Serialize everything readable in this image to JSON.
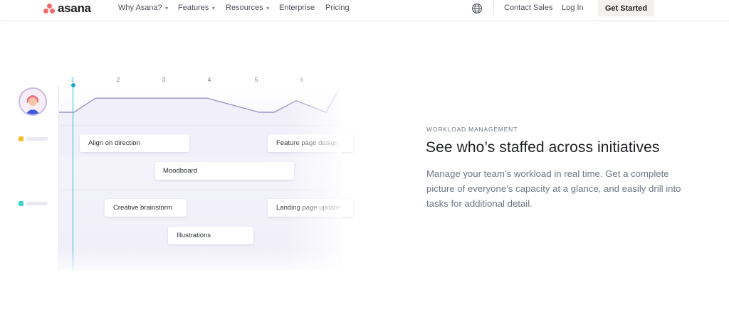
{
  "nav": {
    "logo_text": "asana",
    "links": [
      {
        "label": "Why Asana?",
        "has_caret": true
      },
      {
        "label": "Features",
        "has_caret": true
      },
      {
        "label": "Resources",
        "has_caret": true
      },
      {
        "label": "Enterprise",
        "has_caret": false
      },
      {
        "label": "Pricing",
        "has_caret": false
      }
    ],
    "globe_icon": "globe-icon",
    "contact_sales": "Contact Sales",
    "log_in": "Log In",
    "get_started": "Get Started"
  },
  "illustration": {
    "timeline_ticks": [
      "1",
      "2",
      "3",
      "4",
      "5",
      "6"
    ],
    "active_tick": "1",
    "workload_line_levels": [
      0.0,
      0.0,
      0.55,
      0.55,
      0.55,
      0.55,
      0.0,
      0.0,
      0.45,
      0.0,
      0.9
    ],
    "rows": [
      {
        "legend_color": "#f2c12e",
        "tasks": [
          "Align on direction",
          "Feature page design",
          "Moodboard"
        ]
      },
      {
        "legend_color": "#3ad6c8",
        "tasks": [
          "Creative brainstorm",
          "Landing page update",
          "Illustrations"
        ]
      }
    ]
  },
  "section": {
    "eyebrow": "WORKLOAD MANAGEMENT",
    "headline": "See who’s staffed across initiatives",
    "body": "Manage your team’s workload in real time. Get a complete picture of everyone’s capacity at a glance, and easily drill into tasks for additional detail."
  },
  "colors": {
    "brand_coral": "#f06a6a",
    "timeline_accent": "#1aa4c9",
    "graph_line": "#9b97c9",
    "cta_bg": "#f2f1ef"
  }
}
